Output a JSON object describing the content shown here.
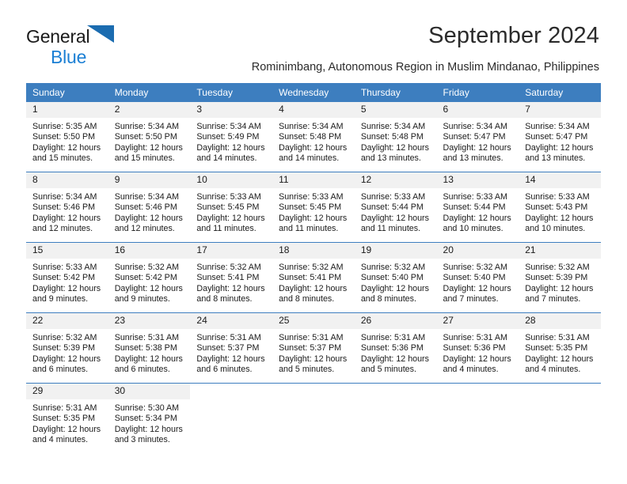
{
  "brand": {
    "name_part1": "General",
    "name_part2": "Blue",
    "icon": "triangle-logo"
  },
  "header": {
    "title": "September 2024",
    "subtitle": "Rominimbang, Autonomous Region in Muslim Mindanao, Philippines"
  },
  "colors": {
    "header_blue": "#3d7ebf",
    "brand_blue": "#1b7fd4",
    "daynum_band": "#f1f1f1",
    "text": "#1a1a1a"
  },
  "calendar": {
    "weekday_headers": [
      "Sunday",
      "Monday",
      "Tuesday",
      "Wednesday",
      "Thursday",
      "Friday",
      "Saturday"
    ],
    "weeks": [
      [
        {
          "day": "1",
          "sunrise": "Sunrise: 5:35 AM",
          "sunset": "Sunset: 5:50 PM",
          "daylight": "Daylight: 12 hours and 15 minutes."
        },
        {
          "day": "2",
          "sunrise": "Sunrise: 5:34 AM",
          "sunset": "Sunset: 5:50 PM",
          "daylight": "Daylight: 12 hours and 15 minutes."
        },
        {
          "day": "3",
          "sunrise": "Sunrise: 5:34 AM",
          "sunset": "Sunset: 5:49 PM",
          "daylight": "Daylight: 12 hours and 14 minutes."
        },
        {
          "day": "4",
          "sunrise": "Sunrise: 5:34 AM",
          "sunset": "Sunset: 5:48 PM",
          "daylight": "Daylight: 12 hours and 14 minutes."
        },
        {
          "day": "5",
          "sunrise": "Sunrise: 5:34 AM",
          "sunset": "Sunset: 5:48 PM",
          "daylight": "Daylight: 12 hours and 13 minutes."
        },
        {
          "day": "6",
          "sunrise": "Sunrise: 5:34 AM",
          "sunset": "Sunset: 5:47 PM",
          "daylight": "Daylight: 12 hours and 13 minutes."
        },
        {
          "day": "7",
          "sunrise": "Sunrise: 5:34 AM",
          "sunset": "Sunset: 5:47 PM",
          "daylight": "Daylight: 12 hours and 13 minutes."
        }
      ],
      [
        {
          "day": "8",
          "sunrise": "Sunrise: 5:34 AM",
          "sunset": "Sunset: 5:46 PM",
          "daylight": "Daylight: 12 hours and 12 minutes."
        },
        {
          "day": "9",
          "sunrise": "Sunrise: 5:34 AM",
          "sunset": "Sunset: 5:46 PM",
          "daylight": "Daylight: 12 hours and 12 minutes."
        },
        {
          "day": "10",
          "sunrise": "Sunrise: 5:33 AM",
          "sunset": "Sunset: 5:45 PM",
          "daylight": "Daylight: 12 hours and 11 minutes."
        },
        {
          "day": "11",
          "sunrise": "Sunrise: 5:33 AM",
          "sunset": "Sunset: 5:45 PM",
          "daylight": "Daylight: 12 hours and 11 minutes."
        },
        {
          "day": "12",
          "sunrise": "Sunrise: 5:33 AM",
          "sunset": "Sunset: 5:44 PM",
          "daylight": "Daylight: 12 hours and 11 minutes."
        },
        {
          "day": "13",
          "sunrise": "Sunrise: 5:33 AM",
          "sunset": "Sunset: 5:44 PM",
          "daylight": "Daylight: 12 hours and 10 minutes."
        },
        {
          "day": "14",
          "sunrise": "Sunrise: 5:33 AM",
          "sunset": "Sunset: 5:43 PM",
          "daylight": "Daylight: 12 hours and 10 minutes."
        }
      ],
      [
        {
          "day": "15",
          "sunrise": "Sunrise: 5:33 AM",
          "sunset": "Sunset: 5:42 PM",
          "daylight": "Daylight: 12 hours and 9 minutes."
        },
        {
          "day": "16",
          "sunrise": "Sunrise: 5:32 AM",
          "sunset": "Sunset: 5:42 PM",
          "daylight": "Daylight: 12 hours and 9 minutes."
        },
        {
          "day": "17",
          "sunrise": "Sunrise: 5:32 AM",
          "sunset": "Sunset: 5:41 PM",
          "daylight": "Daylight: 12 hours and 8 minutes."
        },
        {
          "day": "18",
          "sunrise": "Sunrise: 5:32 AM",
          "sunset": "Sunset: 5:41 PM",
          "daylight": "Daylight: 12 hours and 8 minutes."
        },
        {
          "day": "19",
          "sunrise": "Sunrise: 5:32 AM",
          "sunset": "Sunset: 5:40 PM",
          "daylight": "Daylight: 12 hours and 8 minutes."
        },
        {
          "day": "20",
          "sunrise": "Sunrise: 5:32 AM",
          "sunset": "Sunset: 5:40 PM",
          "daylight": "Daylight: 12 hours and 7 minutes."
        },
        {
          "day": "21",
          "sunrise": "Sunrise: 5:32 AM",
          "sunset": "Sunset: 5:39 PM",
          "daylight": "Daylight: 12 hours and 7 minutes."
        }
      ],
      [
        {
          "day": "22",
          "sunrise": "Sunrise: 5:32 AM",
          "sunset": "Sunset: 5:39 PM",
          "daylight": "Daylight: 12 hours and 6 minutes."
        },
        {
          "day": "23",
          "sunrise": "Sunrise: 5:31 AM",
          "sunset": "Sunset: 5:38 PM",
          "daylight": "Daylight: 12 hours and 6 minutes."
        },
        {
          "day": "24",
          "sunrise": "Sunrise: 5:31 AM",
          "sunset": "Sunset: 5:37 PM",
          "daylight": "Daylight: 12 hours and 6 minutes."
        },
        {
          "day": "25",
          "sunrise": "Sunrise: 5:31 AM",
          "sunset": "Sunset: 5:37 PM",
          "daylight": "Daylight: 12 hours and 5 minutes."
        },
        {
          "day": "26",
          "sunrise": "Sunrise: 5:31 AM",
          "sunset": "Sunset: 5:36 PM",
          "daylight": "Daylight: 12 hours and 5 minutes."
        },
        {
          "day": "27",
          "sunrise": "Sunrise: 5:31 AM",
          "sunset": "Sunset: 5:36 PM",
          "daylight": "Daylight: 12 hours and 4 minutes."
        },
        {
          "day": "28",
          "sunrise": "Sunrise: 5:31 AM",
          "sunset": "Sunset: 5:35 PM",
          "daylight": "Daylight: 12 hours and 4 minutes."
        }
      ],
      [
        {
          "day": "29",
          "sunrise": "Sunrise: 5:31 AM",
          "sunset": "Sunset: 5:35 PM",
          "daylight": "Daylight: 12 hours and 4 minutes."
        },
        {
          "day": "30",
          "sunrise": "Sunrise: 5:30 AM",
          "sunset": "Sunset: 5:34 PM",
          "daylight": "Daylight: 12 hours and 3 minutes."
        },
        {
          "day": "",
          "sunrise": "",
          "sunset": "",
          "daylight": ""
        },
        {
          "day": "",
          "sunrise": "",
          "sunset": "",
          "daylight": ""
        },
        {
          "day": "",
          "sunrise": "",
          "sunset": "",
          "daylight": ""
        },
        {
          "day": "",
          "sunrise": "",
          "sunset": "",
          "daylight": ""
        },
        {
          "day": "",
          "sunrise": "",
          "sunset": "",
          "daylight": ""
        }
      ]
    ]
  }
}
